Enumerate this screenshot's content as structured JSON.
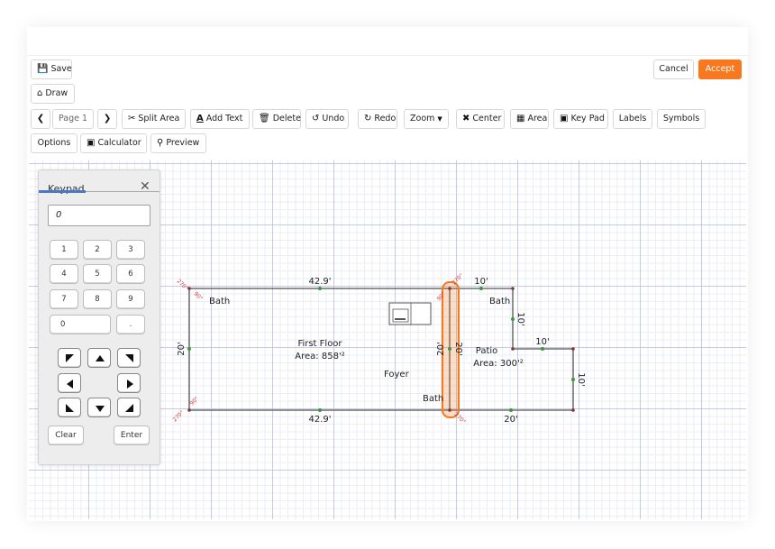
{
  "toolbar": {
    "save": "Save",
    "draw": "Draw",
    "cancel": "Cancel",
    "accept": "Accept",
    "page": "Page 1",
    "split_area": "Split Area",
    "add_text": "Add Text",
    "delete": "Delete",
    "undo": "Undo",
    "redo": "Redo",
    "zoom": "Zoom",
    "center": "Center",
    "area": "Area",
    "key_pad": "Key Pad",
    "labels": "Labels",
    "symbols": "Symbols",
    "options": "Options",
    "calculator": "Calculator",
    "preview": "Preview"
  },
  "keypad": {
    "title": "Keypad",
    "display": "0",
    "keys": [
      "1",
      "2",
      "3",
      "4",
      "5",
      "6",
      "7",
      "8",
      "9",
      "0",
      "."
    ],
    "clear": "Clear",
    "enter": "Enter"
  },
  "plan": {
    "first_floor": {
      "name": "First Floor",
      "area": "Area: 858'²"
    },
    "patio": {
      "name": "Patio",
      "area": "Area: 300'²"
    },
    "rooms": {
      "bath1": "Bath",
      "bath2": "Bath",
      "bath3": "Bath",
      "foyer": "Foyer"
    },
    "dims": {
      "top": "42.9'",
      "bottom": "42.9'",
      "left": "20'",
      "split_left": "20'",
      "split_right": "20'",
      "patio_top": "10'",
      "patio_right_upper": "10'",
      "patio_step": "10'",
      "patio_right_lower": "10'",
      "patio_bottom": "20'"
    },
    "angles": {
      "tl_outer": "270°",
      "tl_inner": "90°",
      "bl_outer": "270°",
      "bl_inner": "90°",
      "split_top_left": "90°",
      "split_top_right": "270°",
      "split_bottom": "270°"
    },
    "colors": {
      "wall": "#555555",
      "angle": "#d43b3b",
      "node": "#3a9a3a",
      "selection": "#f47a20"
    }
  }
}
